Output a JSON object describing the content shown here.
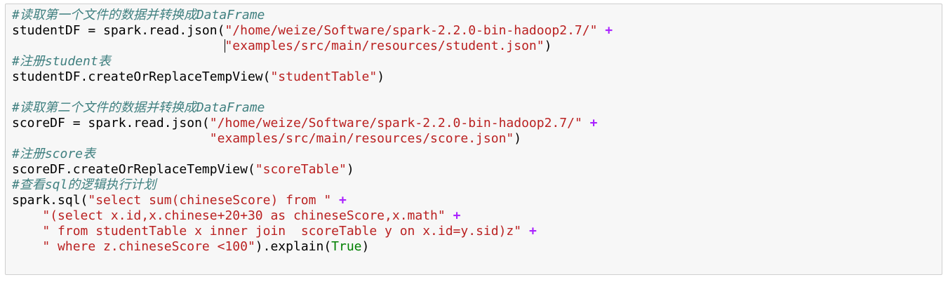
{
  "cell": {
    "lines": [
      [
        {
          "t": "comment",
          "v": "#读取第一个文件的数据并转换成DataFrame"
        }
      ],
      [
        {
          "t": "plain",
          "v": "studentDF = spark.read.json("
        },
        {
          "t": "str",
          "v": "\"/home/weize/Software/spark-2.2.0-bin-hadoop2.7/\""
        },
        {
          "t": "plain",
          "v": " "
        },
        {
          "t": "op",
          "v": "+"
        }
      ],
      [
        {
          "t": "plain",
          "v": "                            "
        },
        {
          "t": "cursor"
        },
        {
          "t": "str",
          "v": "\"examples/src/main/resources/student.json\""
        },
        {
          "t": "plain",
          "v": ")"
        }
      ],
      [
        {
          "t": "comment",
          "v": "#注册student表"
        }
      ],
      [
        {
          "t": "plain",
          "v": "studentDF.createOrReplaceTempView("
        },
        {
          "t": "str",
          "v": "\"studentTable\""
        },
        {
          "t": "plain",
          "v": ")"
        }
      ],
      [],
      [
        {
          "t": "comment",
          "v": "#读取第二个文件的数据并转换成DataFrame"
        }
      ],
      [
        {
          "t": "plain",
          "v": "scoreDF = spark.read.json("
        },
        {
          "t": "str",
          "v": "\"/home/weize/Software/spark-2.2.0-bin-hadoop2.7/\""
        },
        {
          "t": "plain",
          "v": " "
        },
        {
          "t": "op",
          "v": "+"
        }
      ],
      [
        {
          "t": "plain",
          "v": "                          "
        },
        {
          "t": "str",
          "v": "\"examples/src/main/resources/score.json\""
        },
        {
          "t": "plain",
          "v": ")"
        }
      ],
      [
        {
          "t": "comment",
          "v": "#注册score表"
        }
      ],
      [
        {
          "t": "plain",
          "v": "scoreDF.createOrReplaceTempView("
        },
        {
          "t": "str",
          "v": "\"scoreTable\""
        },
        {
          "t": "plain",
          "v": ")"
        }
      ],
      [
        {
          "t": "comment",
          "v": "#查看sql的逻辑执行计划"
        }
      ],
      [
        {
          "t": "plain",
          "v": "spark.sql("
        },
        {
          "t": "str",
          "v": "\"select sum(chineseScore) from \""
        },
        {
          "t": "plain",
          "v": " "
        },
        {
          "t": "op",
          "v": "+"
        }
      ],
      [
        {
          "t": "plain",
          "v": "    "
        },
        {
          "t": "str",
          "v": "\"(select x.id,x.chinese+20+30 as chineseScore,x.math\""
        },
        {
          "t": "plain",
          "v": " "
        },
        {
          "t": "op",
          "v": "+"
        }
      ],
      [
        {
          "t": "plain",
          "v": "    "
        },
        {
          "t": "str",
          "v": "\" from studentTable x inner join  scoreTable y on x.id=y.sid)z\""
        },
        {
          "t": "plain",
          "v": " "
        },
        {
          "t": "op",
          "v": "+"
        }
      ],
      [
        {
          "t": "plain",
          "v": "    "
        },
        {
          "t": "str",
          "v": "\" where z.chineseScore <100\""
        },
        {
          "t": "plain",
          "v": ").explain("
        },
        {
          "t": "kw",
          "v": "True"
        },
        {
          "t": "plain",
          "v": ")"
        }
      ]
    ]
  },
  "colors": {
    "comment": "#408080",
    "string": "#ba2121",
    "operator": "#aa22ff",
    "keyword": "#008000",
    "cell_background": "#f7f7f7",
    "cell_border": "#cfcfcf"
  }
}
